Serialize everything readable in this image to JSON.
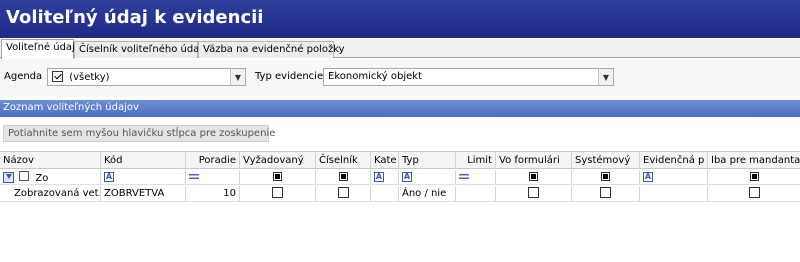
{
  "window": {
    "title": "Voliteľný údaj k evidencii"
  },
  "tabs": [
    {
      "label": "Voliteľné údaje",
      "active": true
    },
    {
      "label": "Číselník voliteľného údaja",
      "active": false
    },
    {
      "label": "Väzba na evidenčné položky",
      "active": false
    }
  ],
  "filters": {
    "agenda_label": "Agenda",
    "agenda_value": "(všetky)",
    "agenda_checked": true,
    "typ_label": "Typ evidencie",
    "typ_value": "Ekonomický objekt"
  },
  "section": {
    "title": "Zoznam voliteľných údajov"
  },
  "grid": {
    "group_hint": "Potiahnite sem myšou hlavičku stĺpca pre zoskupenie",
    "columns": [
      "Názov",
      "Kód",
      "Poradie",
      "Vyžadovaný",
      "Číselník",
      "Kate",
      "Typ",
      "Limit",
      "Vo formulári",
      "Systémový",
      "Evidenčná p",
      "Iba pre mandanta"
    ],
    "filter_row": {
      "nazov": "Zo"
    },
    "rows": [
      {
        "nazov": "Zobrazovaná vet...",
        "kod": "ZOBRVETVA",
        "poradie": "10",
        "vyzadovany": false,
        "ciselnik": false,
        "typ": "Áno / nie",
        "vo_formulari": false,
        "systemovy": false,
        "iba_pre_mandanta": false
      }
    ]
  },
  "colors": {
    "title_bg": "#1f2a86",
    "section_bg": "#5478c8",
    "accent": "#3c5bb0"
  }
}
